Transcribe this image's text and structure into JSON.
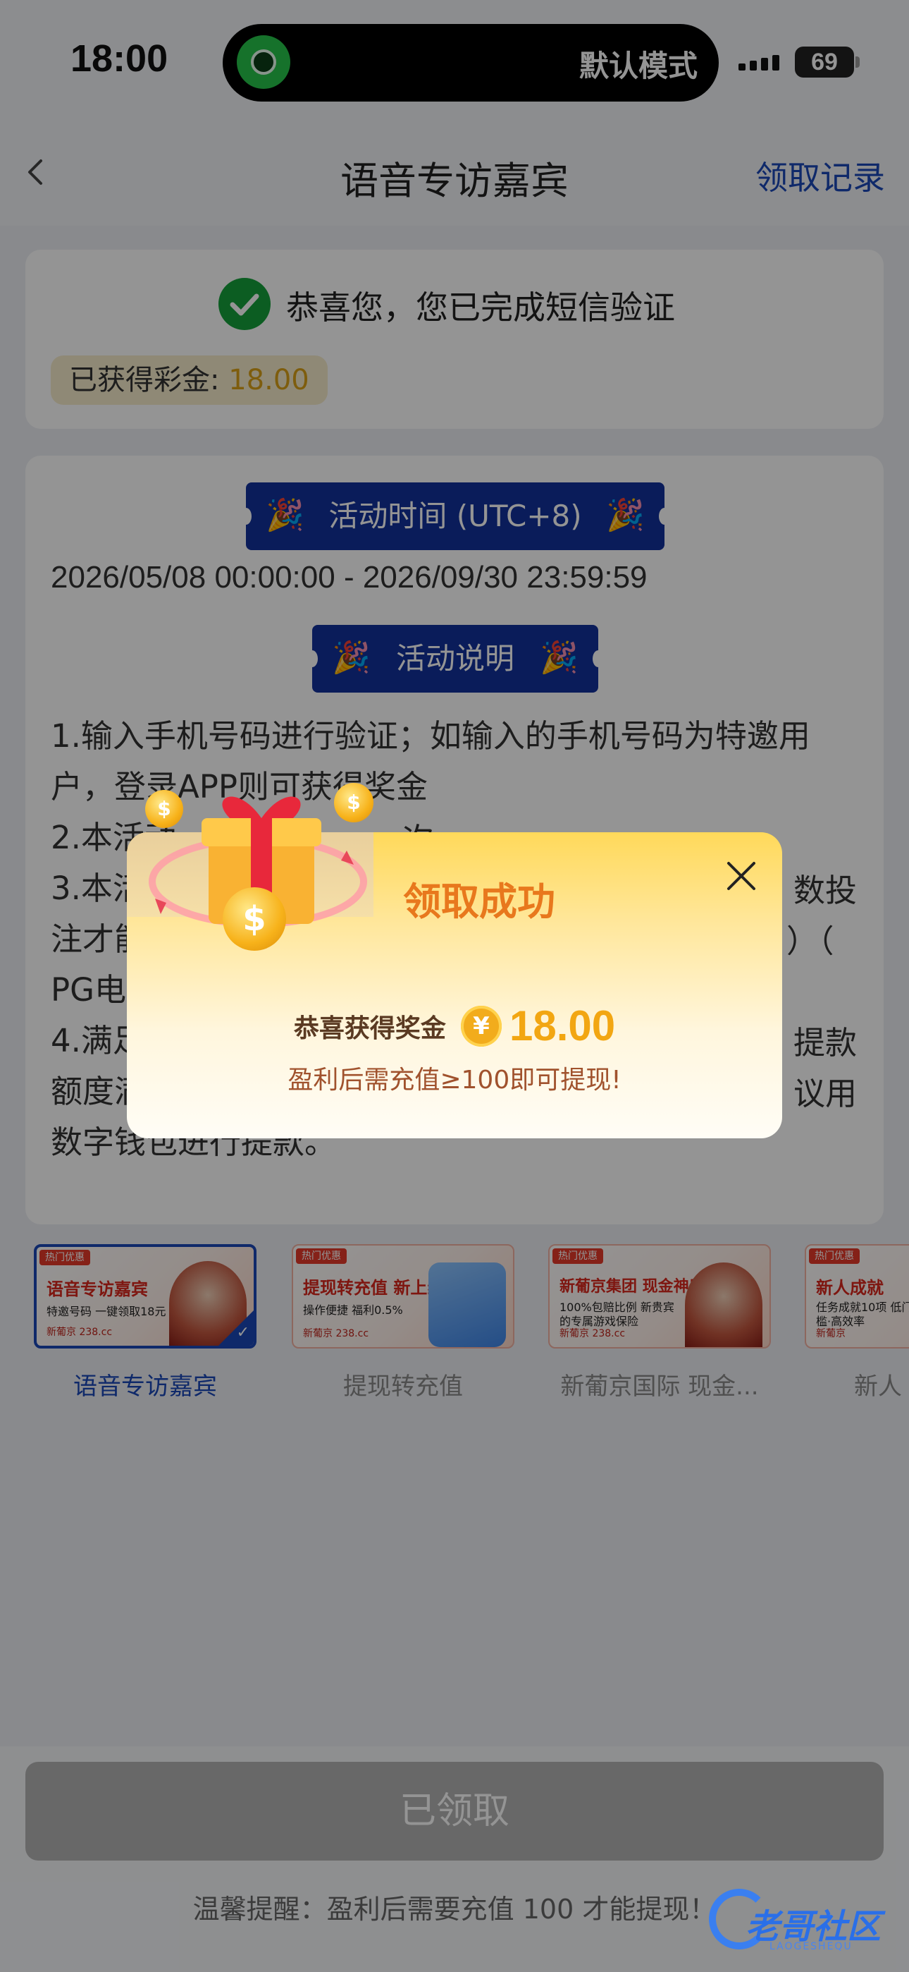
{
  "status_bar": {
    "time": "18:00",
    "island_text": "默认模式",
    "battery": "69",
    "icons": [
      "island-app-icon",
      "signal-icon",
      "battery-icon"
    ]
  },
  "nav": {
    "back_icon": "chevron-left-icon",
    "title": "语音专访嘉宾",
    "right_link": "领取记录"
  },
  "verify": {
    "message": "恭喜您，您已完成短信验证",
    "bonus_label": "已获得彩金: ",
    "bonus_amount": "18.00"
  },
  "activity": {
    "time_tag": "活动时间 (UTC+8)",
    "time_range": "2026/05/08 00:00:00 - 2026/09/30 23:59:59",
    "desc_tag": "活动说明",
    "rules": [
      "1.输入手机号码进行验证；如输入的手机号码为特邀用户，登录APP则可获得奖金",
      "2.本活动",
      "3.本活动",
      "注才能",
      "PG电",
      "4.满足",
      "额度满",
      "数字钱包进行提款。"
    ],
    "rules_visible_right": [
      "一次",
      "数投",
      "）（",
      "提款",
      "议用"
    ]
  },
  "carousel": [
    {
      "badge": "热门优惠",
      "headline": "语音专访嘉宾",
      "sub": "特邀号码 一键领取18元",
      "logo": "新葡京 238.cc",
      "label": "语音专访嘉宾",
      "selected": true
    },
    {
      "badge": "热门优惠",
      "headline": "提现转充值 新上线",
      "sub": "操作便捷 福利0.5%",
      "logo": "新葡京 238.cc",
      "label": "提现转充值",
      "selected": false
    },
    {
      "badge": "热门优惠",
      "headline": "新葡京集团 现金神盾",
      "sub": "100%包赔比例 新贵宾的专属游戏保险",
      "logo": "新葡京 238.cc",
      "label": "新葡京国际 现金...",
      "selected": false
    },
    {
      "badge": "热门优惠",
      "headline": "新人成就",
      "sub": "任务成就10项 低门槛·高效率",
      "logo": "新葡京",
      "label": "新人",
      "selected": false
    }
  ],
  "bottom": {
    "button": "已领取",
    "tip": "温馨提醒：盈利后需要充值 100 才能提现！",
    "watermark": "老哥社区",
    "watermark_sub": "LAOGESHEQU"
  },
  "modal": {
    "title": "领取成功",
    "amount_label": "恭喜获得奖金",
    "currency_icon": "¥",
    "amount": "18.00",
    "note": "盈利后需充值≥100即可提现!",
    "close_icon": "close-icon",
    "art_icon": "gift-coins-icon"
  },
  "colors": {
    "accent": "#1a48b7",
    "tag_bg": "#12319b",
    "success": "#15a03c",
    "gold": "#f2a612",
    "modal_title": "#e8781d"
  }
}
